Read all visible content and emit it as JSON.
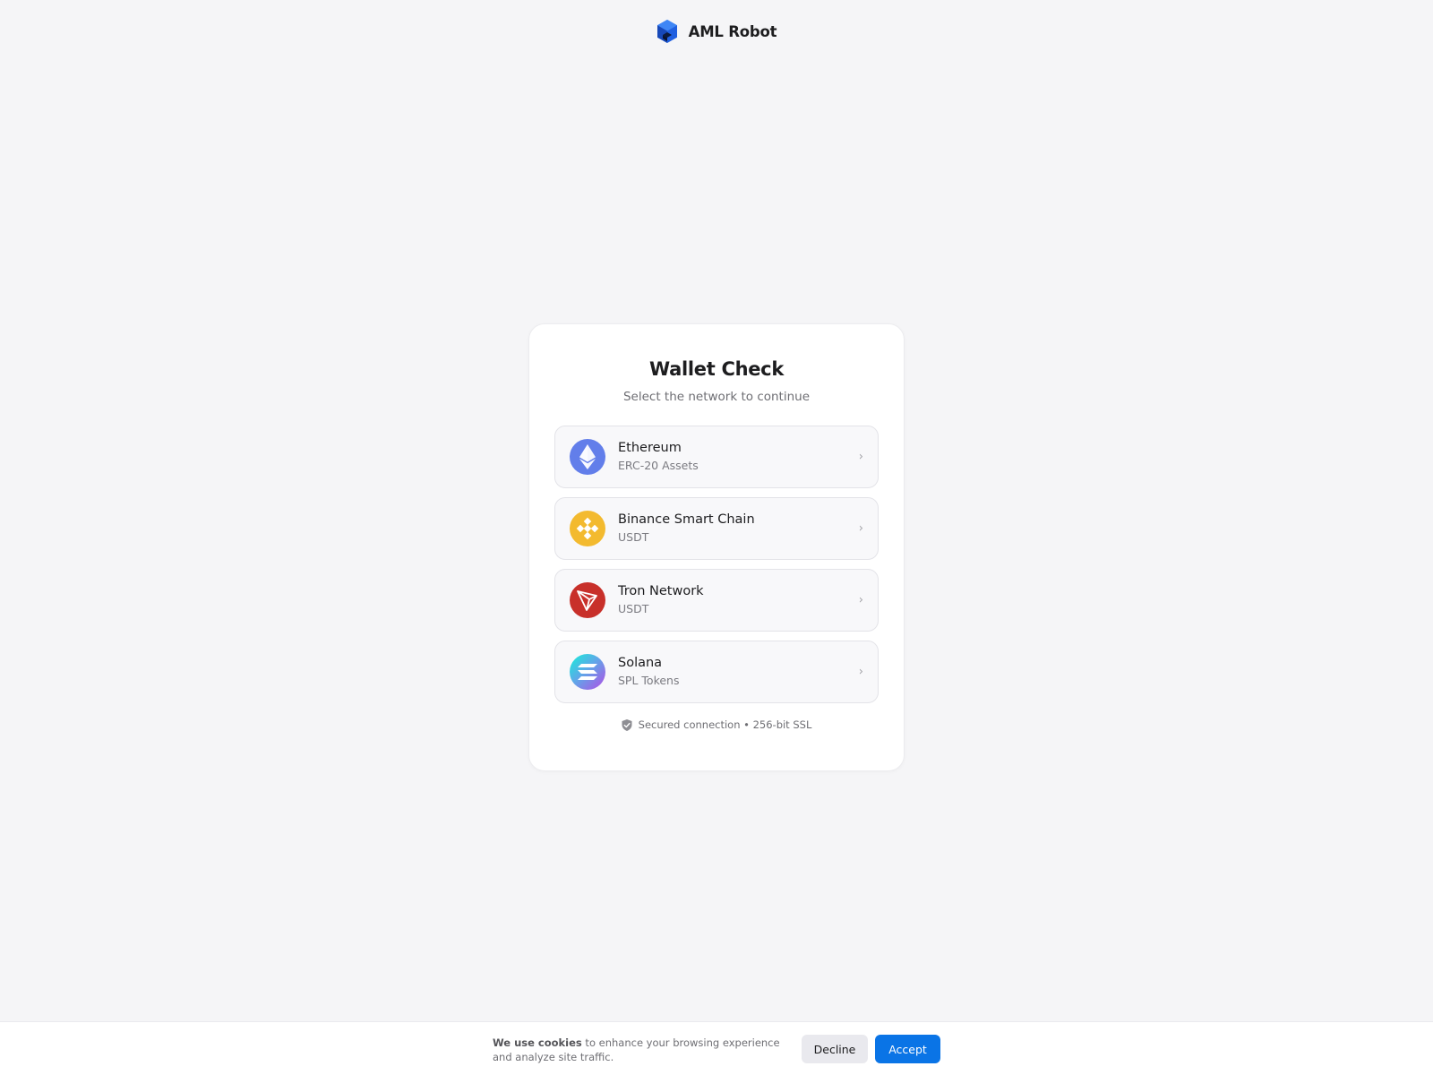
{
  "header": {
    "logo_icon": "hexagon-cube-icon",
    "brand_name": "AML Robot"
  },
  "card": {
    "title": "Wallet Check",
    "subtitle": "Select the network to continue",
    "networks": [
      {
        "name": "Ethereum",
        "subtitle": "ERC-20 Assets",
        "icon": "ethereum-icon",
        "color": "#627eea"
      },
      {
        "name": "Binance Smart Chain",
        "subtitle": "USDT",
        "icon": "binance-icon",
        "color": "#f3ba2f"
      },
      {
        "name": "Tron Network",
        "subtitle": "USDT",
        "icon": "tron-icon",
        "color": "#c8302a"
      },
      {
        "name": "Solana",
        "subtitle": "SPL Tokens",
        "icon": "solana-icon",
        "color": "#9945ff"
      }
    ],
    "chevron": "›",
    "security_note": "Secured connection • 256-bit SSL",
    "security_icon": "shield-check-icon"
  },
  "cookie_bar": {
    "lead": "We use cookies",
    "text": " to enhance your browsing experience and analyze site traffic.",
    "decline_label": "Decline",
    "accept_label": "Accept",
    "accent_color": "#0a74e6"
  }
}
